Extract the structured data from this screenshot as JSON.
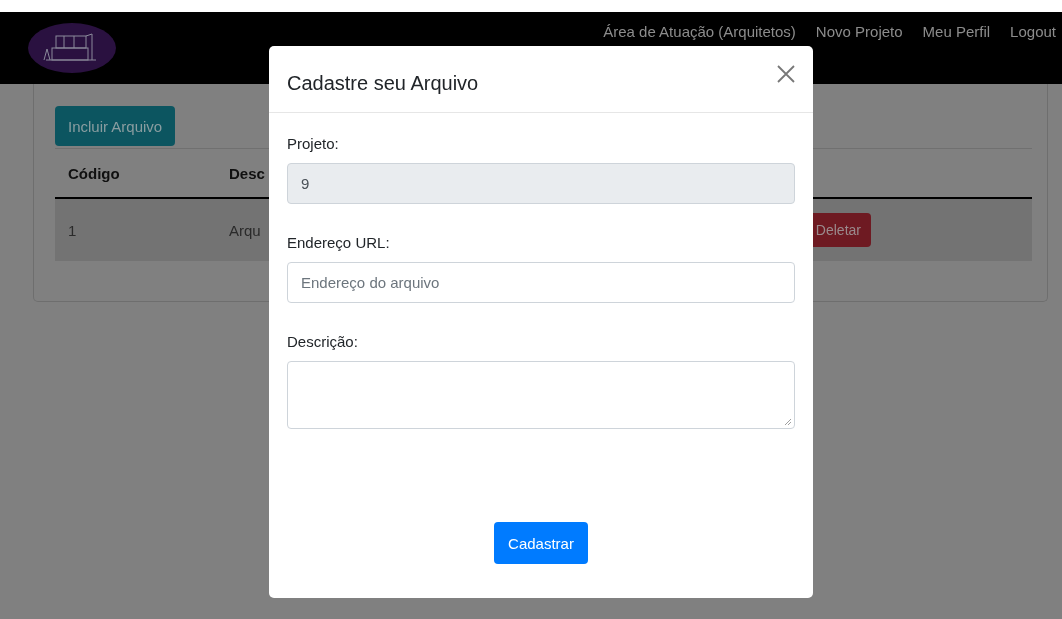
{
  "navbar": {
    "links": [
      "Área de Atuação (Arquitetos)",
      "Novo Projeto",
      "Meu Perfil",
      "Logout"
    ]
  },
  "page": {
    "add_button": "Incluir Arquivo",
    "table": {
      "columns": [
        "Código",
        "Desc"
      ],
      "rows": [
        {
          "cells": [
            "1",
            "Arqu"
          ],
          "action": "Deletar"
        }
      ]
    }
  },
  "modal": {
    "title": "Cadastre seu Arquivo",
    "fields": [
      {
        "kind": "input",
        "label": "Projeto:",
        "value": "9",
        "disabled": true
      },
      {
        "kind": "input",
        "label": "Endereço URL:",
        "placeholder": "Endereço do arquivo",
        "disabled": false
      },
      {
        "kind": "textarea",
        "label": "Descrição:",
        "disabled": false
      }
    ],
    "submit": "Cadastrar"
  }
}
